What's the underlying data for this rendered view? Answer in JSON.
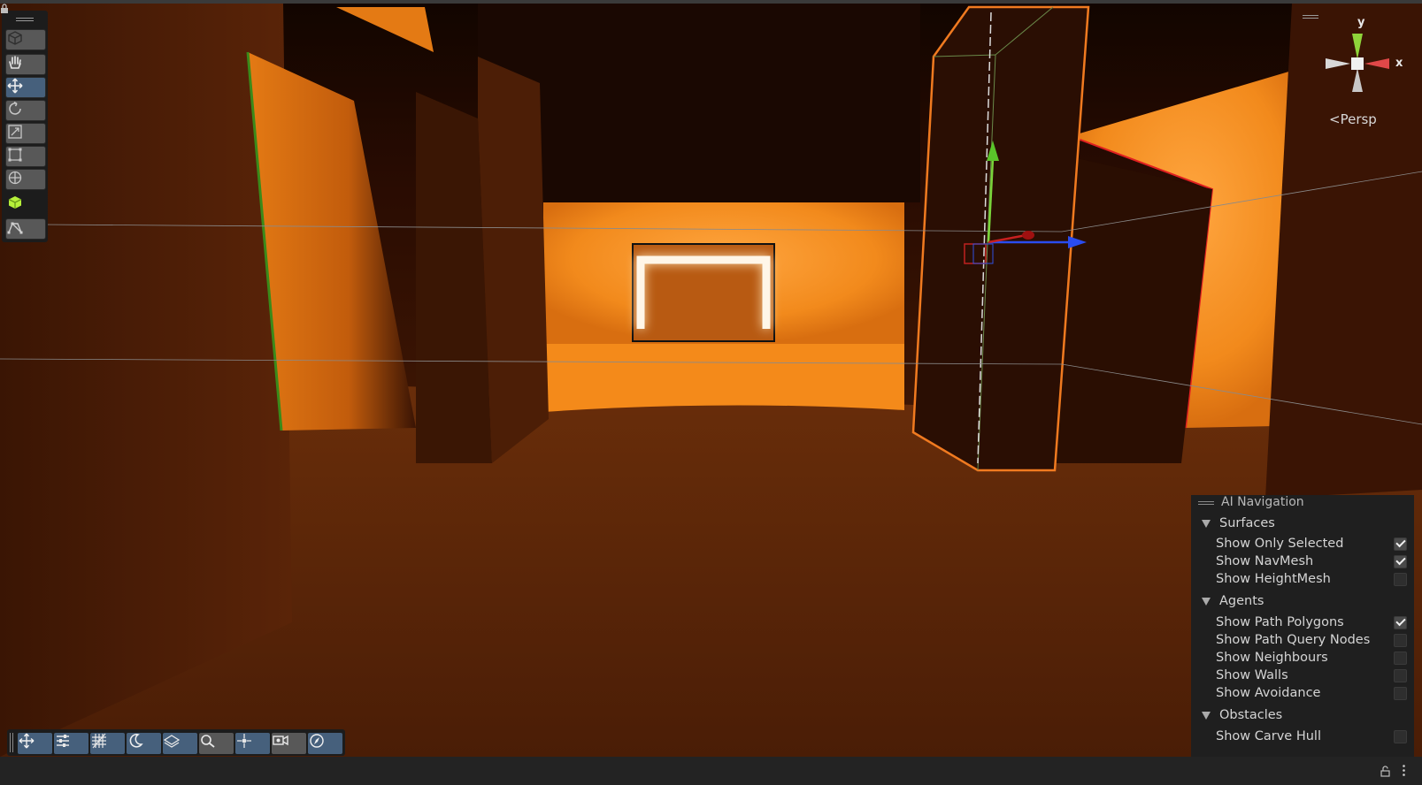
{
  "toolbar_left": {
    "tools": [
      {
        "name": "view-tool",
        "icon": "cube-outline-icon",
        "active": false
      },
      {
        "name": "hand-tool",
        "icon": "hand-icon",
        "active": false
      },
      {
        "name": "move-tool",
        "icon": "move-arrows-icon",
        "active": true
      },
      {
        "name": "rotate-tool",
        "icon": "rotate-icon",
        "active": false
      },
      {
        "name": "scale-tool",
        "icon": "scale-icon",
        "active": false
      },
      {
        "name": "rect-tool",
        "icon": "rect-transform-icon",
        "active": false
      },
      {
        "name": "transform-tool",
        "icon": "transform-icon",
        "active": false
      },
      {
        "name": "custom-tool",
        "icon": "green-cube-icon",
        "active": false
      },
      {
        "name": "navmesh-tool",
        "icon": "navmesh-path-icon",
        "active": false
      }
    ]
  },
  "gizmo": {
    "y_label": "y",
    "x_label": "x",
    "projection_label": "Persp",
    "colors": {
      "y": "#8fd43a",
      "x": "#e04848",
      "neutral": "#c8c8c8"
    }
  },
  "ai_navigation": {
    "title": "AI Navigation",
    "sections": [
      {
        "label": "Surfaces",
        "options": [
          {
            "label": "Show Only Selected",
            "checked": true
          },
          {
            "label": "Show NavMesh",
            "checked": true
          },
          {
            "label": "Show HeightMesh",
            "checked": false
          }
        ]
      },
      {
        "label": "Agents",
        "options": [
          {
            "label": "Show Path Polygons",
            "checked": true
          },
          {
            "label": "Show Path Query Nodes",
            "checked": false
          },
          {
            "label": "Show Neighbours",
            "checked": false
          },
          {
            "label": "Show Walls",
            "checked": false
          },
          {
            "label": "Show Avoidance",
            "checked": false
          }
        ]
      },
      {
        "label": "Obstacles",
        "options": [
          {
            "label": "Show Carve Hull",
            "checked": false
          }
        ]
      }
    ]
  },
  "bottom_toolbar": {
    "buttons": [
      {
        "name": "move-gizmo-toggle",
        "icon": "move-arrows-icon"
      },
      {
        "name": "scene-settings",
        "icon": "sliders-icon"
      },
      {
        "name": "grid-toggle",
        "icon": "grid-icon"
      },
      {
        "name": "lighting-toggle",
        "icon": "moon-icon"
      },
      {
        "name": "surface-snap",
        "icon": "layers-icon"
      },
      {
        "name": "search-scene",
        "icon": "search-icon"
      },
      {
        "name": "pivot-toggle",
        "icon": "pivot-icon"
      },
      {
        "name": "camera-visibility",
        "icon": "camera-eye-icon"
      },
      {
        "name": "navigation-overlay",
        "icon": "compass-icon"
      }
    ]
  },
  "colors": {
    "accent_active": "#46607c",
    "scene_orange": "#f08a1c",
    "panel_bg": "#1f1f1f"
  }
}
